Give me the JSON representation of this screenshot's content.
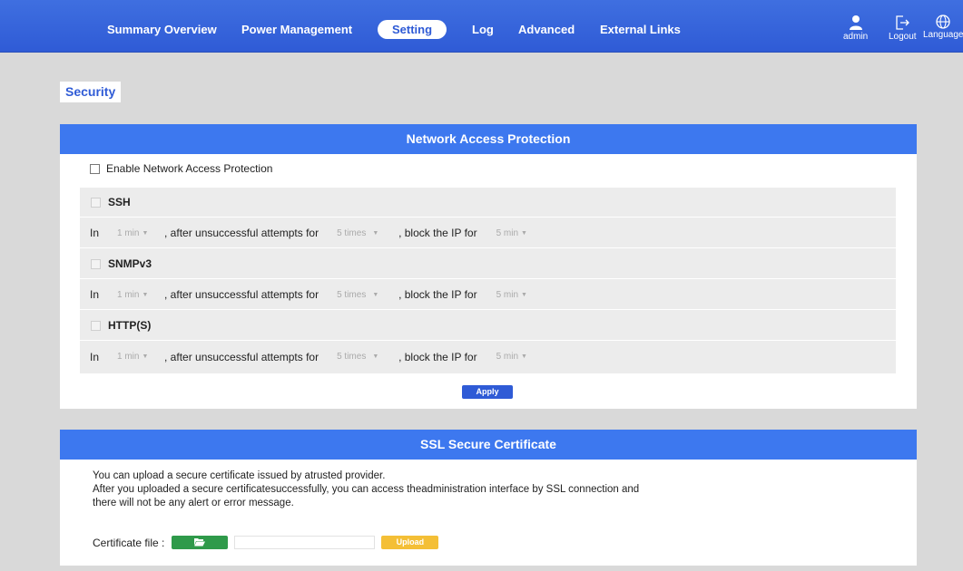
{
  "nav": {
    "items": [
      {
        "label": "Summary Overview"
      },
      {
        "label": "Power Management"
      },
      {
        "label": "Setting"
      },
      {
        "label": "Log"
      },
      {
        "label": "Advanced"
      },
      {
        "label": "External Links"
      }
    ],
    "active": "Setting",
    "user_label": "admin",
    "logout_label": "Logout",
    "language_label": "Language"
  },
  "section_tab": "Security",
  "nap": {
    "title": "Network Access Protection",
    "enable_label": "Enable Network Access Protection",
    "protocols": [
      {
        "name": "SSH",
        "in_label": "In",
        "window": "1 min",
        "after_label": ", after unsuccessful attempts for",
        "attempts": "5 times",
        "block_label": ", block the IP for",
        "block_time": "5 min"
      },
      {
        "name": "SNMPv3",
        "in_label": "In",
        "window": "1 min",
        "after_label": ", after unsuccessful attempts for",
        "attempts": "5 times",
        "block_label": ", block the IP for",
        "block_time": "5 min"
      },
      {
        "name": "HTTP(S)",
        "in_label": "In",
        "window": "1 min",
        "after_label": ", after unsuccessful attempts for",
        "attempts": "5 times",
        "block_label": ", block the IP for",
        "block_time": "5 min"
      }
    ],
    "apply_label": "Apply"
  },
  "ssl": {
    "title": "SSL Secure Certificate",
    "line1": "You can upload a secure certificate issued by atrusted provider.",
    "line2": "After you uploaded a secure certificatesuccessfully, you can access theadministration interface by SSL connection and",
    "line3": "there will not be any alert or error message.",
    "cert_label": "Certificate file :",
    "upload_label": "Upload"
  },
  "colors": {
    "accent": "#3d78ef",
    "nav_bg": "#2f5bd6",
    "browse": "#2f9a4a",
    "upload": "#f4bf36"
  }
}
